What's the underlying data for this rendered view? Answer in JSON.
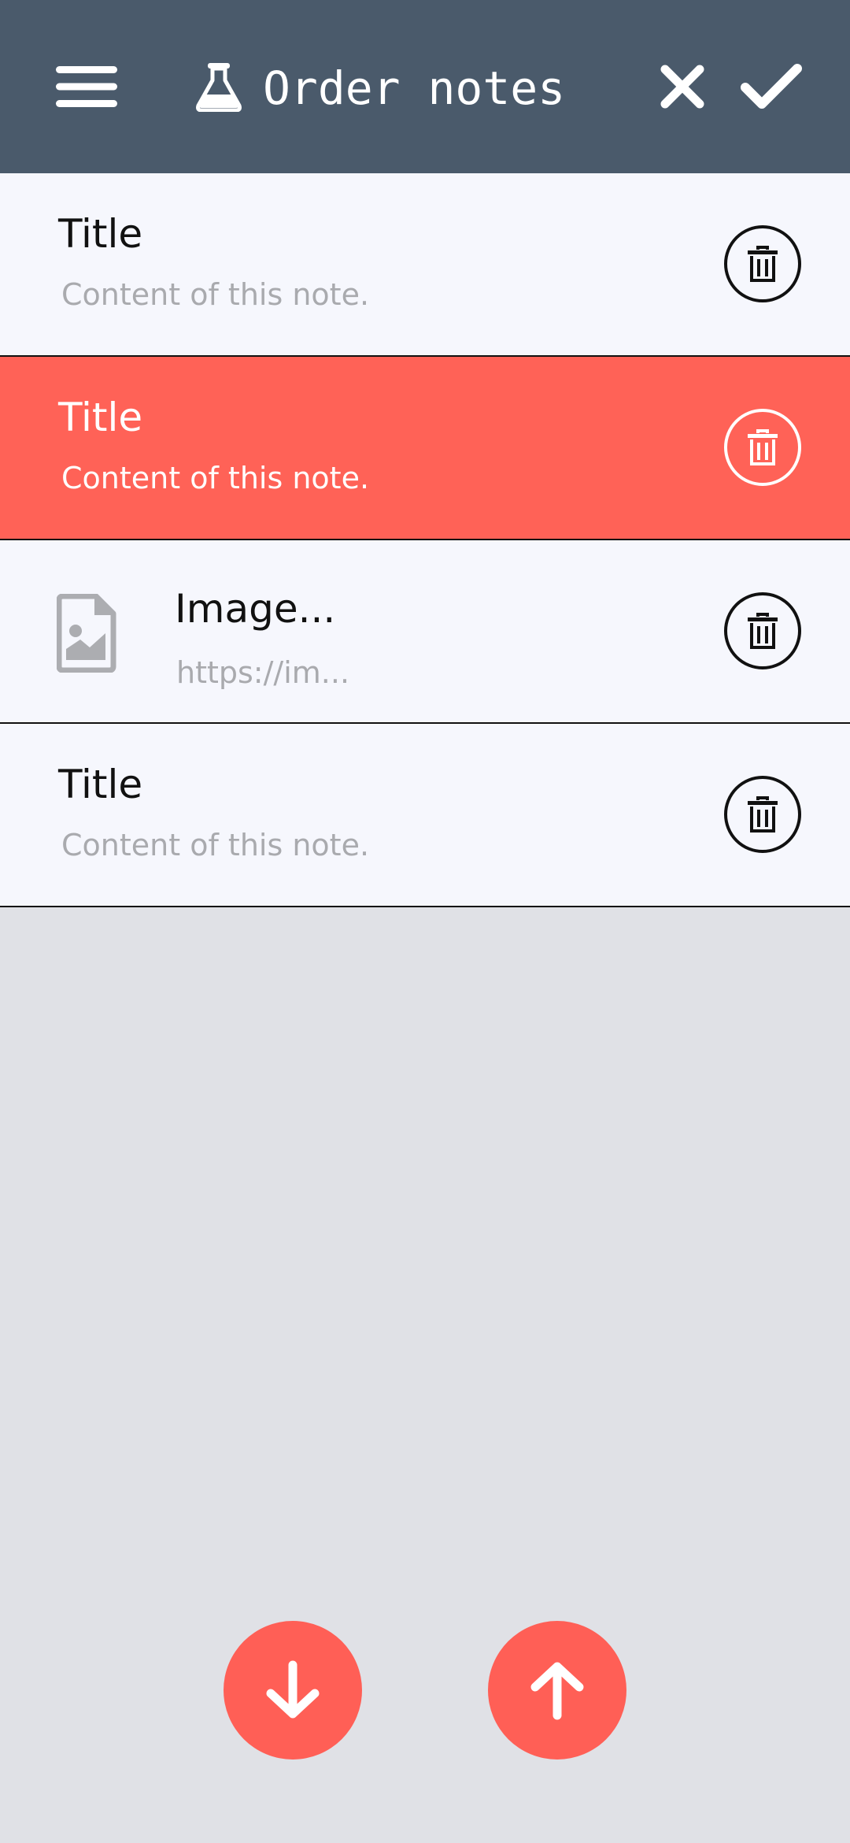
{
  "app_bar": {
    "title": "Order notes",
    "background": "#4a5a6b",
    "icons": {
      "menu": "hamburger-menu-icon",
      "title": "flask-icon",
      "cancel": "close-icon",
      "confirm": "checkmark-icon"
    }
  },
  "notes": [
    {
      "title": "Title",
      "content": "Content of this note.",
      "selected": false
    },
    {
      "title": "Title",
      "content": "Content of this note.",
      "selected": true
    },
    {
      "title": "Image...",
      "content": "https://im...",
      "type": "image",
      "icon": "image-file-icon",
      "selected": false
    },
    {
      "title": "Title",
      "content": "Content of this note.",
      "selected": false
    }
  ],
  "fabs": {
    "move_down": "arrow-down-icon",
    "move_up": "arrow-up-icon"
  },
  "colors": {
    "accent": "#ff6257",
    "list_background": "#f6f7fd",
    "page_background": "#e0e1e6",
    "secondary_text": "#a9aaae"
  }
}
